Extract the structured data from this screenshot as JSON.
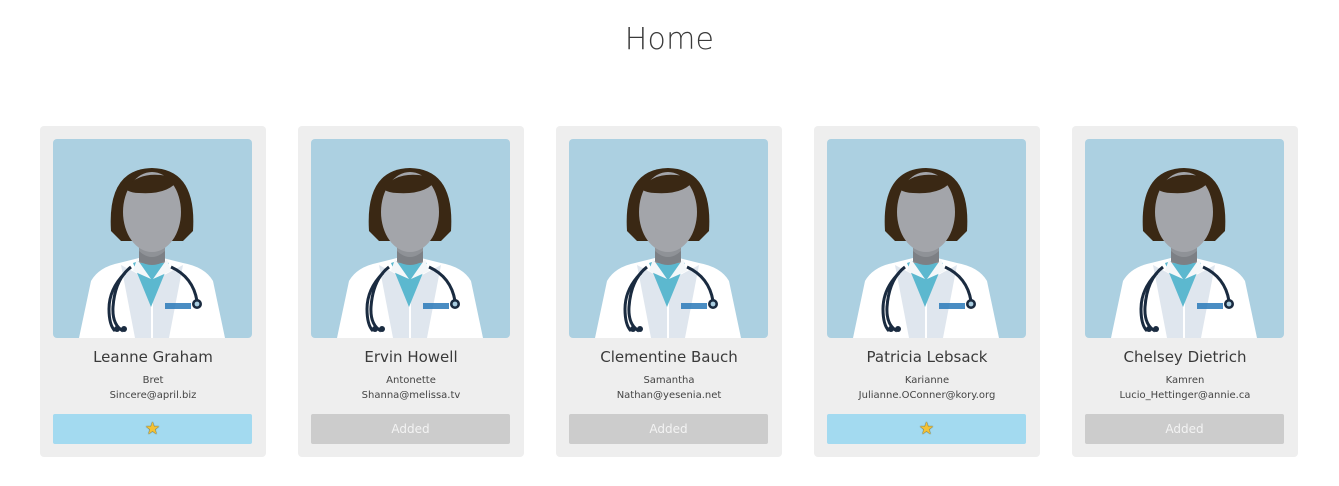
{
  "page": {
    "title": "Home"
  },
  "colors": {
    "card_bg": "#eeeeee",
    "avatar_bg": "#acd0e1",
    "favorite_button_bg": "#a3daf0",
    "added_button_bg": "#cccccc"
  },
  "contacts": [
    {
      "name": "Leanne Graham",
      "username": "Bret",
      "email": "Sincere@april.biz",
      "action": {
        "type": "favorite",
        "label": "",
        "icon": "star-icon"
      }
    },
    {
      "name": "Ervin Howell",
      "username": "Antonette",
      "email": "Shanna@melissa.tv",
      "action": {
        "type": "added",
        "label": "Added"
      }
    },
    {
      "name": "Clementine Bauch",
      "username": "Samantha",
      "email": "Nathan@yesenia.net",
      "action": {
        "type": "added",
        "label": "Added"
      }
    },
    {
      "name": "Patricia Lebsack",
      "username": "Karianne",
      "email": "Julianne.OConner@kory.org",
      "action": {
        "type": "favorite",
        "label": "",
        "icon": "star-icon"
      }
    },
    {
      "name": "Chelsey Dietrich",
      "username": "Kamren",
      "email": "Lucio_Hettinger@annie.ca",
      "action": {
        "type": "added",
        "label": "Added"
      }
    }
  ]
}
